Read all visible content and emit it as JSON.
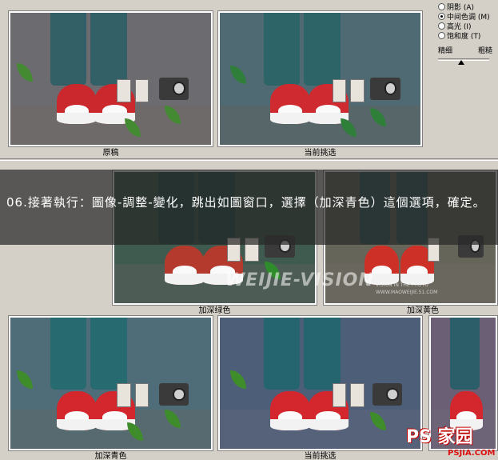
{
  "thumbnails": {
    "original": {
      "caption": "原稿"
    },
    "current_top": {
      "caption": "当前挑选"
    },
    "deeper_green": {
      "caption": "加深绿色"
    },
    "deeper_yellow": {
      "caption": "加深黄色"
    },
    "deeper_cyan": {
      "caption": "加深青色"
    },
    "current_bottom": {
      "caption": "当前挑选"
    }
  },
  "panel": {
    "options": [
      {
        "label": "阴影 (A)",
        "selected": false
      },
      {
        "label": "中间色调 (M)",
        "selected": true
      },
      {
        "label": "高光 (I)",
        "selected": false
      },
      {
        "label": "饱和度 (T)",
        "selected": false
      }
    ],
    "slider_left": "精细",
    "slider_right": "粗糙",
    "slider_value": 0.45
  },
  "instruction": "06.接著執行：圖像-調整-變化，跳出如圖窗口，選擇（加深青色）這個選項，確定。",
  "watermark": {
    "main": "WEIJIE-VISION",
    "sub1": "VISION IN THE PHOTO",
    "sub2": "WWW.MAOWEIJIE.51.COM"
  },
  "logo": {
    "main": "PS 家园",
    "sub": "PSJIA.COM"
  },
  "colors": {
    "original_wall": "#6b6b70",
    "original_ground": "#6e6a69",
    "original_jeans": "#2f5f66",
    "green_wall": "#3f5a4e",
    "green_ground": "#4d5c55",
    "yellow_wall": "#66655a",
    "cyan_wall": "#4f6d78",
    "shoe_red": "#d8242a",
    "leaf_green": "#3f8c2b"
  }
}
